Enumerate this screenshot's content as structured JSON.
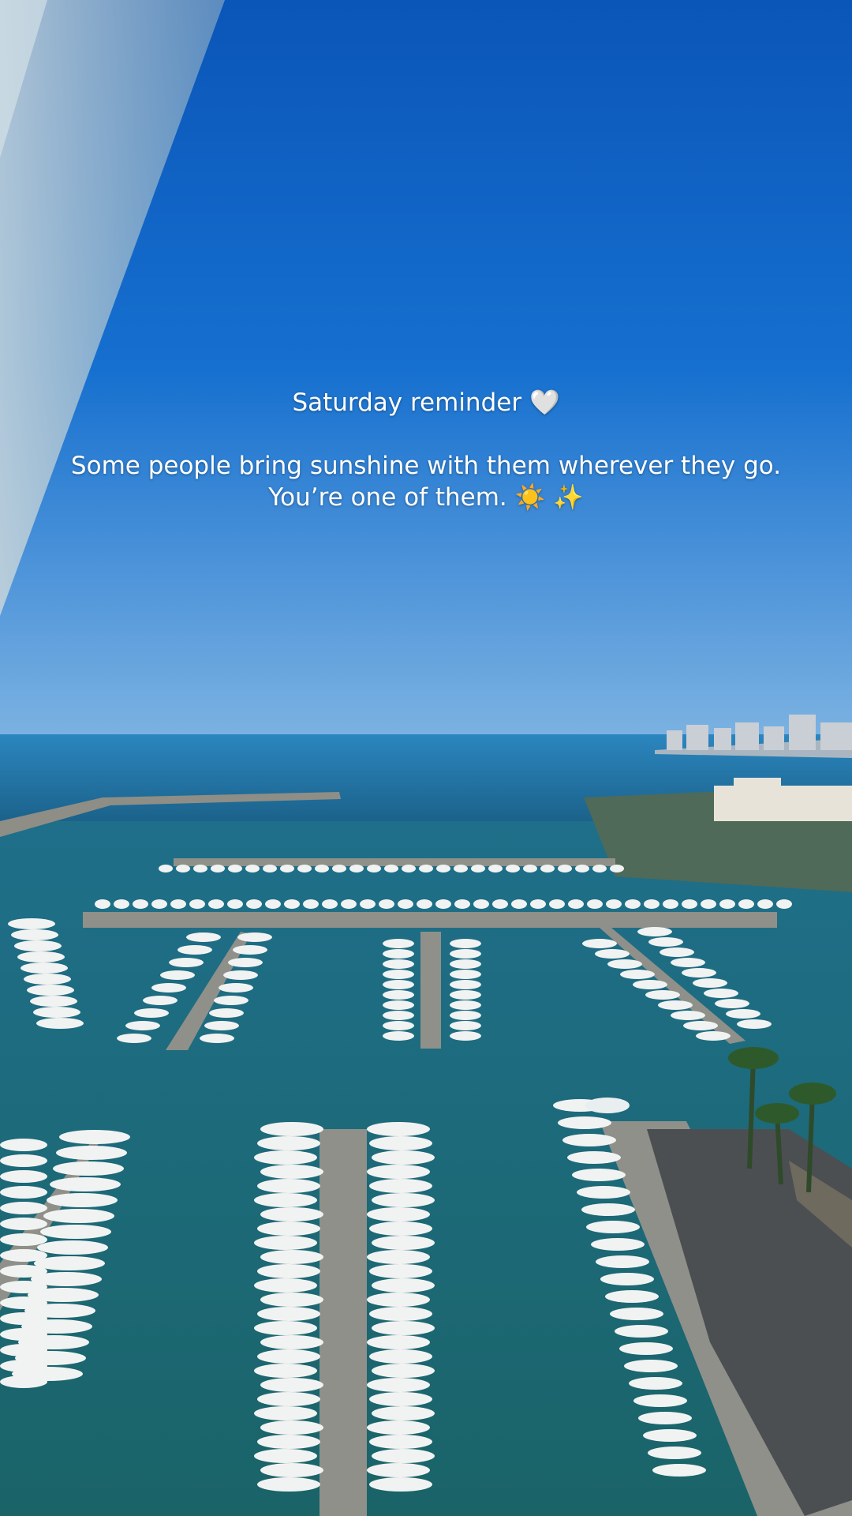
{
  "story": {
    "title": "Saturday reminder",
    "title_emoji": "🤍",
    "line1": "Some people bring sunshine with them wherever they go.",
    "line2": "You’re one of them.",
    "line2_emoji": "☀️ ✨"
  },
  "colors": {
    "sky_top": "#0a5cc2",
    "sky_bottom": "#6aa6dd",
    "sea": "#1d6f9e",
    "marina_water": "#1e6a78",
    "pier": "#8a8c86",
    "boat": "#f1f3f2",
    "text": "#ffffff"
  }
}
